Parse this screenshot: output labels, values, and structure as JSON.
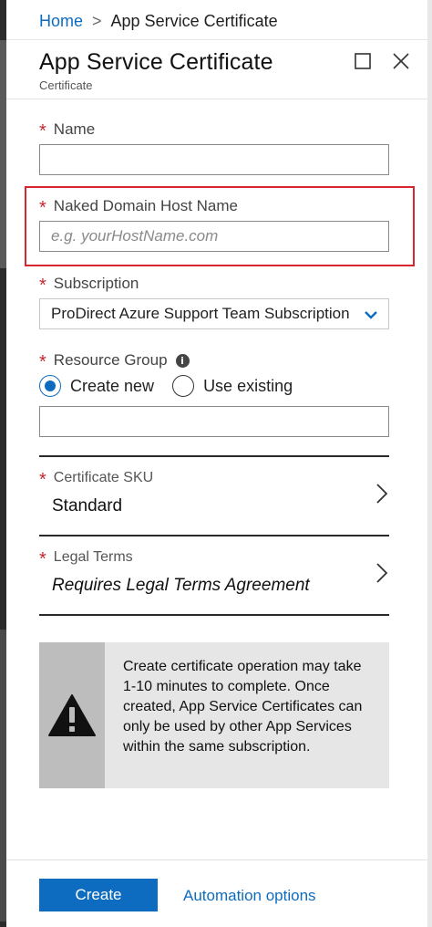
{
  "breadcrumb": {
    "home": "Home",
    "separator": ">",
    "current": "App Service Certificate"
  },
  "blade": {
    "title": "App Service Certificate",
    "subtitle": "Certificate",
    "maximize_icon": "maximize-icon",
    "close_icon": "close-icon"
  },
  "form": {
    "required_marker": "*",
    "name": {
      "label": "Name",
      "value": "",
      "placeholder": ""
    },
    "naked_domain": {
      "label": "Naked Domain Host Name",
      "value": "",
      "placeholder": "e.g. yourHostName.com"
    },
    "subscription": {
      "label": "Subscription",
      "selected": "ProDirect Azure Support Team Subscription"
    },
    "resource_group": {
      "label": "Resource Group",
      "info_glyph": "i",
      "options": [
        {
          "label": "Create new",
          "checked": true
        },
        {
          "label": "Use existing",
          "checked": false
        }
      ],
      "value": ""
    },
    "certificate_sku": {
      "label": "Certificate SKU",
      "value": "Standard"
    },
    "legal_terms": {
      "label": "Legal Terms",
      "value": "Requires Legal Terms Agreement"
    }
  },
  "warning": {
    "icon": "warning-triangle-icon",
    "message": "Create certificate operation may take 1-10 minutes to complete. Once created, App Service Certificates can only be used by other App Services within the same subscription."
  },
  "footer": {
    "create_label": "Create",
    "automation_label": "Automation options"
  },
  "colors": {
    "accent": "#0e6cc0",
    "required": "#c4262e",
    "highlight": "#d7262e"
  }
}
